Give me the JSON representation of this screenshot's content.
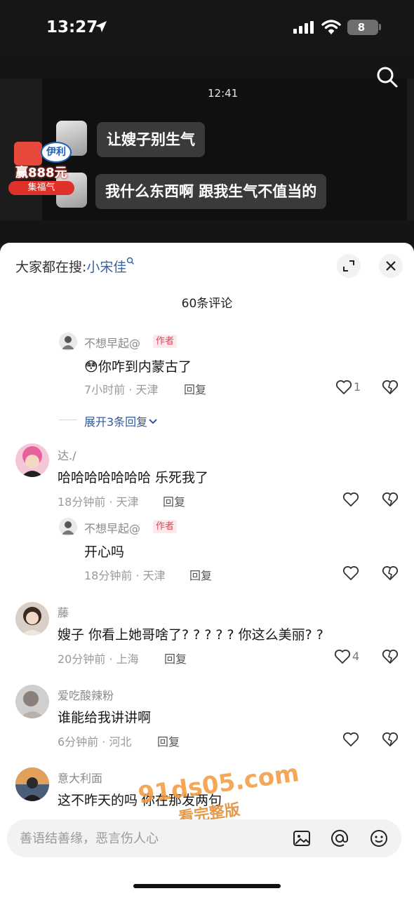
{
  "status_bar": {
    "time": "13:27",
    "battery": "8"
  },
  "video": {
    "clock": "12:41",
    "chat": [
      {
        "text": "让嫂子别生气"
      },
      {
        "text": "我什么东西啊 跟我生气不值当的"
      }
    ],
    "promo": {
      "logo": "伊利",
      "prize": "赢888元",
      "tag": "集福气"
    }
  },
  "sheet": {
    "hot_search_prefix": "大家都在搜:",
    "hot_search_link": "小宋佳",
    "comment_count": "60条评论"
  },
  "comments": [
    {
      "name": "不想早起@",
      "badge": "作者",
      "text": "你咋到内蒙古了",
      "emoji": "😳",
      "time": "7小时前 · 天津",
      "reply": "回复",
      "likes": "1"
    },
    {
      "expand": "展开3条回复"
    },
    {
      "name": "达./",
      "text": "哈哈哈哈哈哈哈 乐死我了",
      "time": "18分钟前 · 天津",
      "reply": "回复",
      "likes": ""
    },
    {
      "name": "不想早起@",
      "badge": "作者",
      "text": "开心吗",
      "time": "18分钟前 · 天津",
      "reply": "回复",
      "likes": ""
    },
    {
      "name": "藤",
      "text": "嫂子 你看上她哥啥了? ? ? ? ? 你这么美丽? ?",
      "time": "20分钟前 · 上海",
      "reply": "回复",
      "likes": "4"
    },
    {
      "name": "爱吃酸辣粉",
      "text": "谁能给我讲讲啊",
      "time": "6分钟前 · 河北",
      "reply": "回复",
      "likes": ""
    },
    {
      "name": "意大利面",
      "text": "这不昨天的吗 你在那发两句"
    }
  ],
  "input": {
    "placeholder": "善语结善缘，恶言伤人心"
  },
  "watermark": {
    "url": "91ds05.com",
    "label": "看完整版"
  },
  "colors": {
    "accent_link": "#3a62a8",
    "author_badge": "#e0455a",
    "watermark": "#f39a3a"
  }
}
